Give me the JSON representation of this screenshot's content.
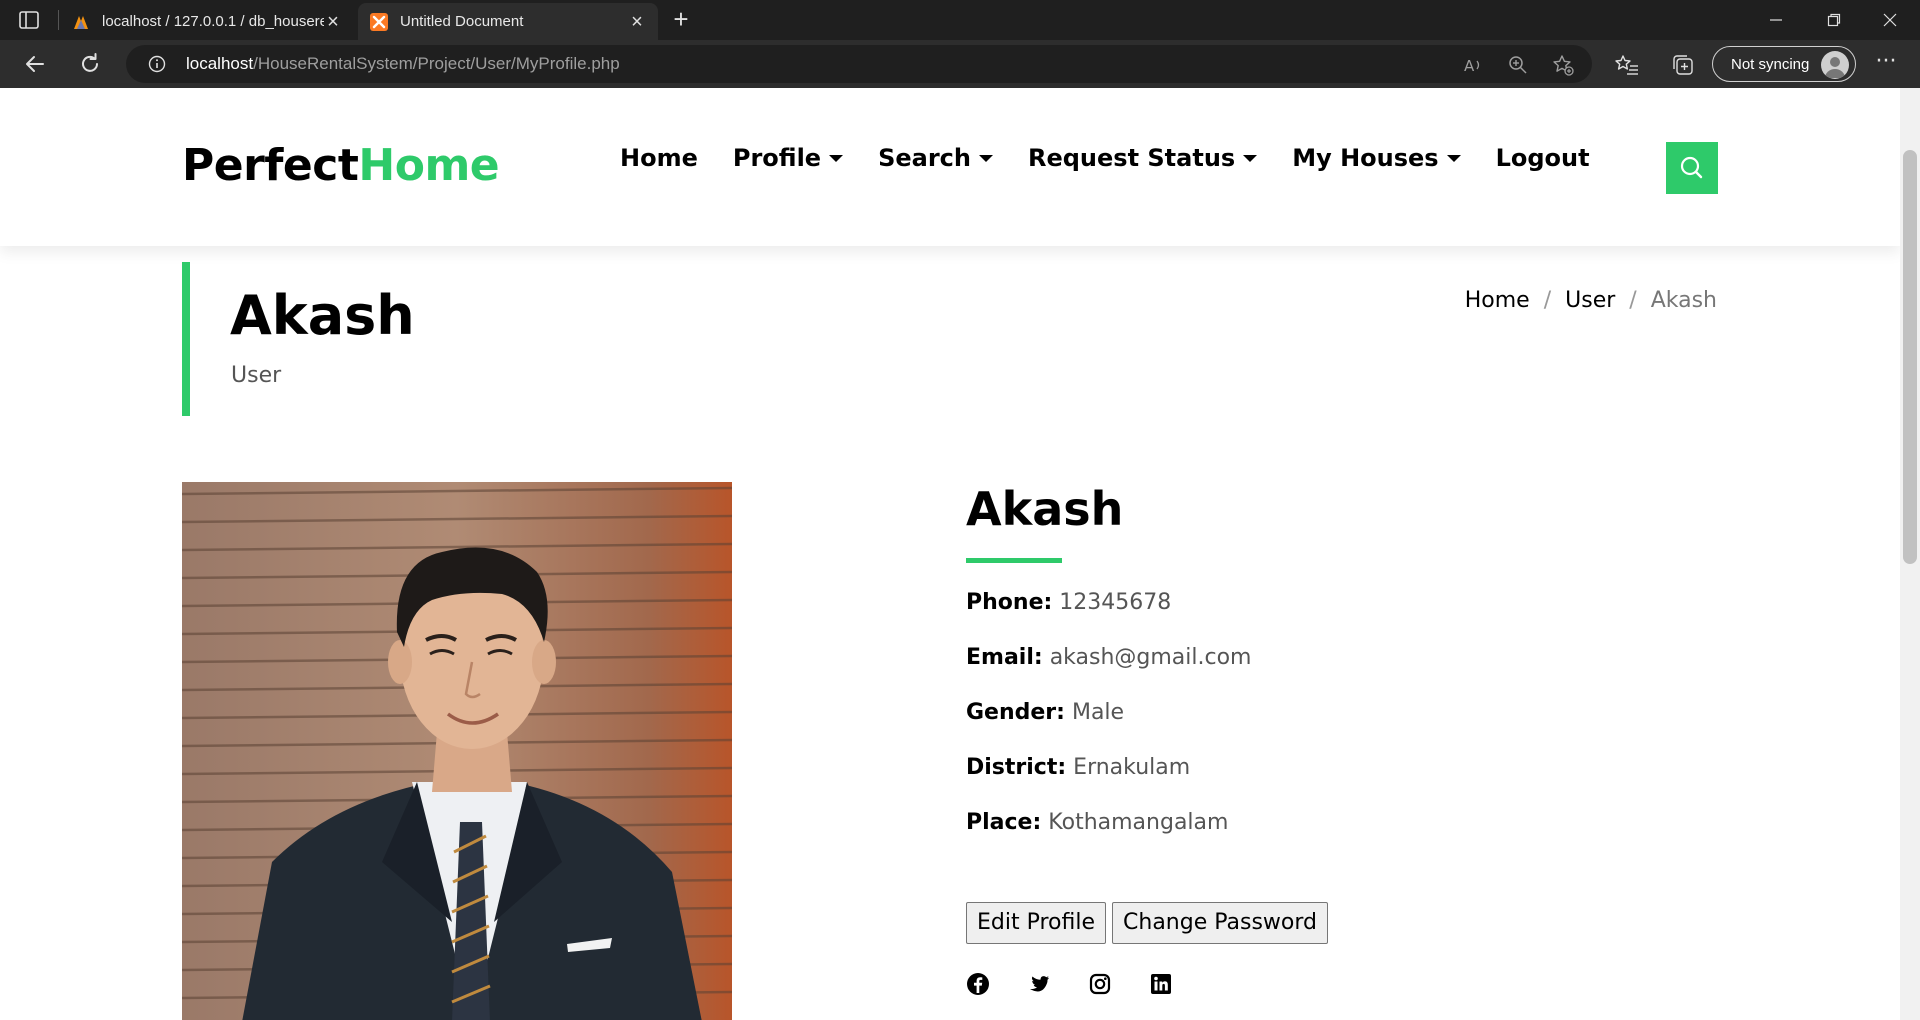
{
  "browser": {
    "tabs": [
      {
        "title": "localhost / 127.0.0.1 / db_houserental",
        "active": false,
        "icon": "phpmyadmin-icon"
      },
      {
        "title": "Untitled Document",
        "active": true,
        "icon": "xampp-icon"
      }
    ],
    "url_host": "localhost",
    "url_path": "/HouseRentalSystem/Project/User/MyProfile.php",
    "sync_label": "Not syncing"
  },
  "site": {
    "logo_part1": "Perfect",
    "logo_part2": "Home",
    "accent_color": "#2eca6a",
    "nav": [
      {
        "label": "Home",
        "dropdown": false
      },
      {
        "label": "Profile",
        "dropdown": true
      },
      {
        "label": "Search",
        "dropdown": true
      },
      {
        "label": "Request Status",
        "dropdown": true
      },
      {
        "label": "My Houses",
        "dropdown": true
      },
      {
        "label": "Logout",
        "dropdown": false
      }
    ]
  },
  "page": {
    "title": "Akash",
    "subtitle": "User",
    "breadcrumb": [
      "Home",
      "User",
      "Akash"
    ]
  },
  "profile": {
    "name": "Akash",
    "fields": [
      {
        "label": "Phone:",
        "value": "12345678"
      },
      {
        "label": "Email:",
        "value": "akash@gmail.com"
      },
      {
        "label": "Gender:",
        "value": "Male"
      },
      {
        "label": "District:",
        "value": "Ernakulam"
      },
      {
        "label": "Place:",
        "value": "Kothamangalam"
      }
    ],
    "edit_button": "Edit Profile",
    "password_button": "Change Password",
    "socials": [
      "facebook-icon",
      "twitter-icon",
      "instagram-icon",
      "linkedin-icon"
    ]
  }
}
